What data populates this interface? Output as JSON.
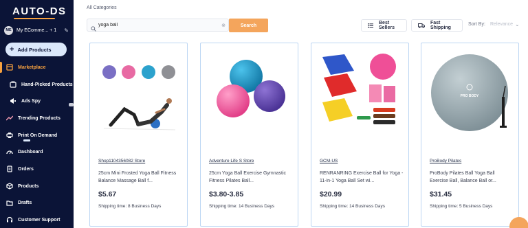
{
  "app": {
    "logo": "AUTO-DS"
  },
  "sidebar": {
    "store": {
      "avatar": "ME",
      "name": "My EComme... + 1"
    },
    "add_products": "Add Products",
    "items": [
      {
        "label": "Marketplace",
        "icon": "storefront-icon",
        "active": true
      },
      {
        "label": "Hand-Picked Products",
        "icon": "hand-picked-icon"
      },
      {
        "label": "Ads Spy",
        "icon": "megaphone-icon"
      },
      {
        "label": "Trending Products",
        "icon": "trending-icon"
      },
      {
        "label": "Print On Demand",
        "icon": "printer-icon"
      },
      {
        "label": "Dashboard",
        "icon": "gauge-icon"
      },
      {
        "label": "Orders",
        "icon": "orders-icon"
      },
      {
        "label": "Products",
        "icon": "box-icon"
      },
      {
        "label": "Drafts",
        "icon": "drafts-icon"
      },
      {
        "label": "Customer Support",
        "icon": "headset-icon"
      }
    ],
    "accent_color": "#f7a13f",
    "background_color": "#0b1437"
  },
  "main": {
    "breadcrumb": "All Categories",
    "search": {
      "value": "yoga ball",
      "button_label": "Search"
    },
    "filters": {
      "best_sellers": "Best Sellers",
      "fast_shipping": "Fast Shipping"
    },
    "sort": {
      "label": "Sort By:",
      "value": "Relevance"
    }
  },
  "products": [
    {
      "store": "Shop1104356082 Store",
      "title": "25cm Mini Frosted Yoga Ball Fitness Balance Massage Ball f...",
      "price": "$5.67",
      "shipping": "Shipping time: 8 Business Days"
    },
    {
      "store": "Adventure Life S Store",
      "title": "25cm Yoga Ball Exercise Gymnastic Fitness Pilates Ball...",
      "price": "$3.80-3.85",
      "shipping": "Shipping time: 14 Business Days"
    },
    {
      "store": "GCM-US",
      "title": "RENRANRING Exercise Ball for Yoga - 11-in-1 Yoga Ball Set wi...",
      "price": "$20.99",
      "shipping": "Shipping time: 14 Business Days"
    },
    {
      "store": "ProBody Pilates",
      "title": "ProBody Pilates Ball Yoga Ball Exercise Ball, Balance Ball or...",
      "price": "$31.45",
      "shipping": "Shipping time: 5 Business Days",
      "image_text": "PRO BODY"
    }
  ]
}
